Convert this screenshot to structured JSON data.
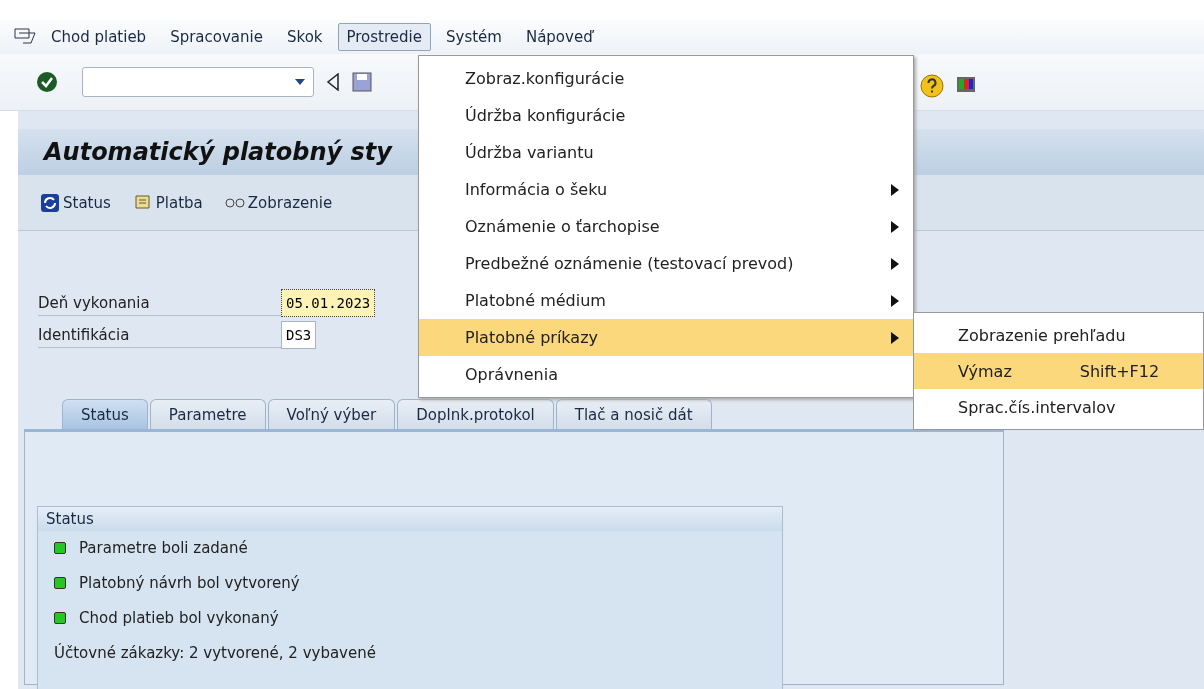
{
  "menubar": [
    {
      "label": "Chod platieb",
      "selected": false
    },
    {
      "label": "Spracovanie",
      "selected": false
    },
    {
      "label": "Skok",
      "selected": false
    },
    {
      "label": "Prostredie",
      "selected": true
    },
    {
      "label": "Systém",
      "selected": false
    },
    {
      "label": "Nápoveď",
      "selected": false
    }
  ],
  "title": "Automatický platobný sty",
  "app_toolbar": [
    {
      "kind": "refresh",
      "label": "Status"
    },
    {
      "kind": "scroll",
      "label": "Platba"
    },
    {
      "kind": "glasses",
      "label": "Zobrazenie"
    }
  ],
  "fields": [
    {
      "label": "Deň vykonania",
      "value": "05.01.2023",
      "focused": true
    },
    {
      "label": "Identifikácia",
      "value": "DS3",
      "focused": false
    }
  ],
  "tabs": [
    {
      "label": "Status",
      "selected": true
    },
    {
      "label": "Parametre",
      "selected": false
    },
    {
      "label": "Voľný výber",
      "selected": false
    },
    {
      "label": "Doplnk.protokol",
      "selected": false
    },
    {
      "label": "Tlač a nosič dát",
      "selected": false
    }
  ],
  "status_group": {
    "title": "Status",
    "lights": [
      {
        "text": "Parametre boli zadané",
        "color": "#22c922"
      },
      {
        "text": "Platobný návrh bol vytvorený",
        "color": "#22c922"
      },
      {
        "text": "Chod platieb bol vykonaný",
        "color": "#22c922"
      }
    ],
    "summary": "Účtovné zákazky: 2 vytvorené, 2 vybavené"
  },
  "menu": {
    "items": [
      {
        "label": "Zobraz.konfigurácie",
        "submenu": false,
        "selected": false
      },
      {
        "label": "Údržba konfigurácie",
        "submenu": false,
        "selected": false
      },
      {
        "label": "Údržba variantu",
        "submenu": false,
        "selected": false
      },
      {
        "label": "Informácia o šeku",
        "submenu": true,
        "selected": false
      },
      {
        "label": "Oznámenie o ťarchopise",
        "submenu": true,
        "selected": false
      },
      {
        "label": "Predbežné oznámenie (testovací prevod)",
        "submenu": true,
        "selected": false
      },
      {
        "label": "Platobné médium",
        "submenu": true,
        "selected": false
      },
      {
        "label": "Platobné príkazy",
        "submenu": true,
        "selected": true
      },
      {
        "label": "Oprávnenia",
        "submenu": false,
        "selected": false
      }
    ]
  },
  "submenu": {
    "items": [
      {
        "label": "Zobrazenie prehľadu",
        "selected": false
      },
      {
        "label": "Výmaz",
        "shortcut": "Shift+F12",
        "selected": true
      },
      {
        "label": "Sprac.čís.intervalov",
        "selected": false
      }
    ]
  }
}
